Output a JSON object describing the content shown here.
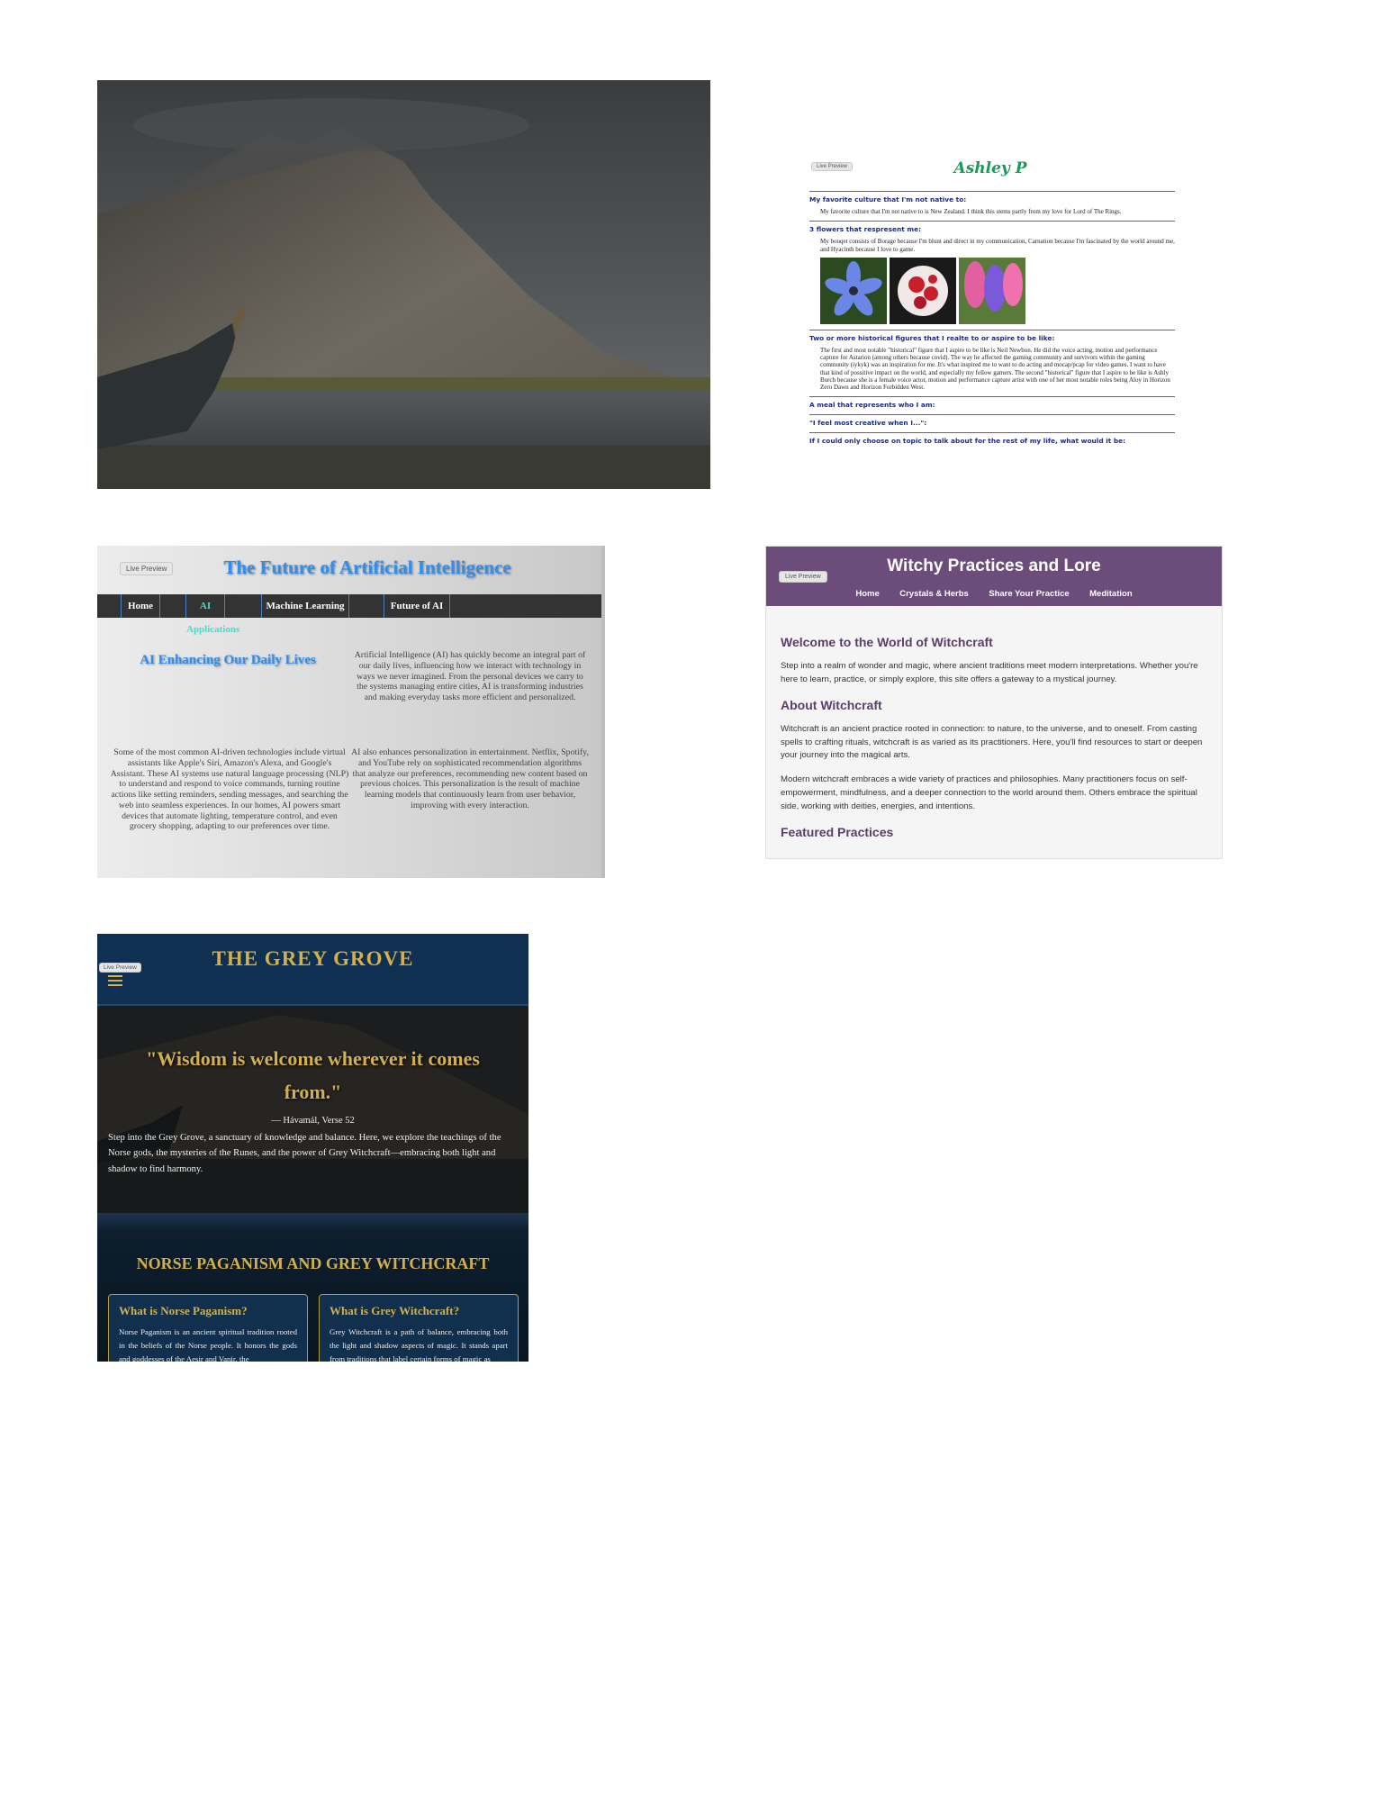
{
  "ashley": {
    "live_preview": "Live Preview",
    "title": "Ashley P",
    "sections": [
      {
        "q": "My favorite culture that I'm not native to:",
        "a": "My favorite culture that I'm not native to is New Zealand. I think this stems partly from my love for Lord of The Rings."
      },
      {
        "q": "3 flowers that respresent me:",
        "a": "My bouqet consists of Borage because I'm blunt and direct in my communication, Carnation because I'm fascinated by the world around me, and Hyacinth because I love to game."
      },
      {
        "q": "Two or more historical figures that I realte to or aspire to be like:",
        "a": "The first and most notable \"historical\" figure that I aspire to be like is Neil Newbon. He did the voice acting, motion and performance capture for Astarion (among others because covid). The way he affected the gaming community and survivors within the gaming community (iykyk) was an inspiration for me. It's what inspired me to want to do acting and mocap/pcap for video games. I want to have that kind of possitive impact on the world, and especially my fellow gamers. The second \"historical\" figure that I aspire to be like is Ashly Burch because she is a female voice actor, motion and performance capture artist with one of her most notable roles being Aloy in Horizon Zero Dawn and Horizon Forbidden West."
      },
      {
        "q": "A meal that represents who I am:",
        "a": ""
      },
      {
        "q": "\"I feel most creative when I...\":",
        "a": ""
      },
      {
        "q": "If I could only choose on topic to talk about for the rest of my life, what would it be:",
        "a": ""
      }
    ]
  },
  "ai": {
    "live_preview": "Live Preview",
    "title": "The Future of Artificial Intelligence",
    "nav": [
      "Home",
      "AI Applications",
      "Machine Learning",
      "Future of AI"
    ],
    "active_nav": "AI Applications",
    "heading": "AI Enhancing Our Daily Lives",
    "p1": "Artificial Intelligence (AI) has quickly become an integral part of our daily lives, influencing how we interact with technology in ways we never imagined. From the personal devices we carry to the systems managing entire cities, AI is transforming industries and making everyday tasks more efficient and personalized.",
    "p2": "Some of the most common AI-driven technologies include virtual assistants like Apple's Siri, Amazon's Alexa, and Google's Assistant. These AI systems use natural language processing (NLP) to understand and respond to voice commands, turning routine actions like setting reminders, sending messages, and searching the web into seamless experiences. In our homes, AI powers smart devices that automate lighting, temperature control, and even grocery shopping, adapting to our preferences over time.",
    "p3": "AI also enhances personalization in entertainment. Netflix, Spotify, and YouTube rely on sophisticated recommendation algorithms that analyze our preferences, recommending new content based on previous choices. This personalization is the result of machine learning models that continuously learn from user behavior, improving with every interaction."
  },
  "witchy": {
    "live_preview": "Live Preview",
    "title": "Witchy Practices and Lore",
    "nav": [
      "Home",
      "Crystals & Herbs",
      "Share Your Practice",
      "Meditation"
    ],
    "h1": "Welcome to the World of Witchcraft",
    "p1": "Step into a realm of wonder and magic, where ancient traditions meet modern interpretations. Whether you're here to learn, practice, or simply explore, this site offers a gateway to a mystical journey.",
    "h2": "About Witchcraft",
    "p2": "Witchcraft is an ancient practice rooted in connection: to nature, to the universe, and to oneself. From casting spells to crafting rituals, witchcraft is as varied as its practitioners. Here, you'll find resources to start or deepen your journey into the magical arts.",
    "p3": "Modern witchcraft embraces a wide variety of practices and philosophies. Many practitioners focus on self-empowerment, mindfulness, and a deeper connection to the world around them. Others embrace the spiritual side, working with deities, energies, and intentions.",
    "h3": "Featured Practices"
  },
  "grove": {
    "live_preview": "Live Preview",
    "title": "THE GREY GROVE",
    "quote": "\"Wisdom is welcome wherever it comes from.\"",
    "cite": "— Hávamál, Verse 52",
    "intro": "Step into the Grey Grove, a sanctuary of knowledge and balance. Here, we explore the teachings of the Norse gods, the mysteries of the Runes, and the power of Grey Witchcraft—embracing both light and shadow to find harmony.",
    "section_title": "NORSE PAGANISM AND GREY WITCHCRAFT",
    "cards": [
      {
        "title": "What is Norse Paganism?",
        "text": "Norse Paganism is an ancient spiritual tradition rooted in the beliefs of the Norse people. It honors the gods and goddesses of the Aesir and Vanir, the"
      },
      {
        "title": "What is Grey Witchcraft?",
        "text": "Grey Witchcraft is a path of balance, embracing both the light and shadow aspects of magic. It stands apart from traditions that label certain forms of magic as"
      }
    ]
  },
  "colors": {
    "ai_blue": "#2f8ff0",
    "witchy_purple": "#6b4c7a",
    "grove_gold": "#d3b04c",
    "grove_navy": "#0f3050",
    "ashley_green": "#1a9a5a",
    "ashley_heading": "#1b2a8c"
  }
}
